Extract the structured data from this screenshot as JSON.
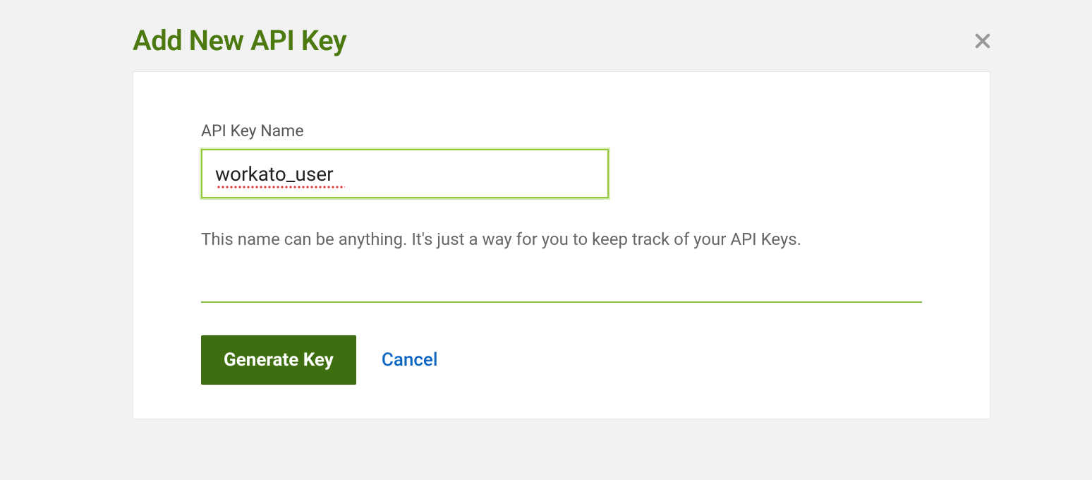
{
  "dialog": {
    "title": "Add New API Key",
    "field_label": "API Key Name",
    "input_value": "workato_user",
    "help_text": "This name can be anything. It's just a way for you to keep track of your API Keys.",
    "generate_label": "Generate Key",
    "cancel_label": "Cancel"
  }
}
